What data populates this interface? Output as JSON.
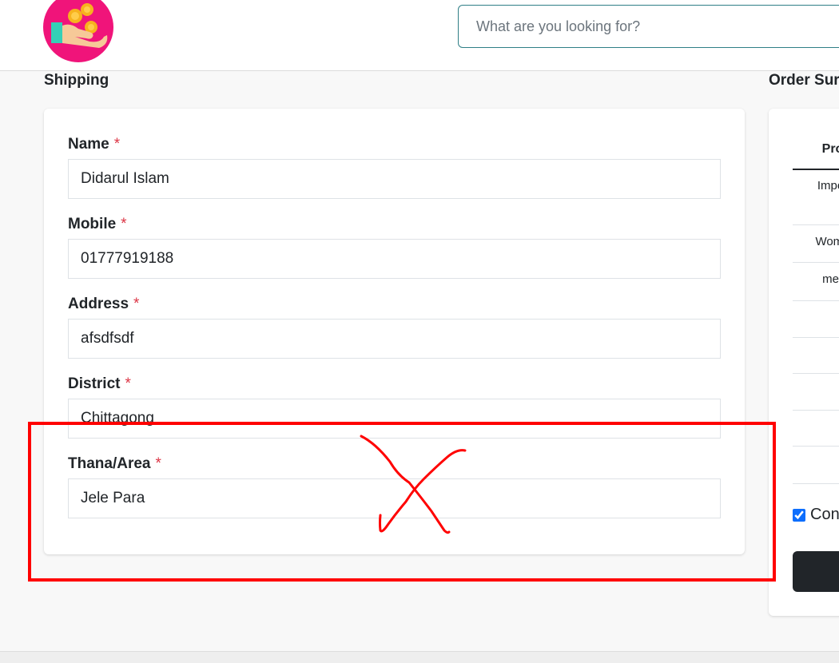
{
  "search": {
    "placeholder": "What are you looking for?"
  },
  "shipping": {
    "title": "Shipping",
    "required_marker": "*",
    "fields": [
      {
        "label": "Name",
        "value": "Didarul Islam"
      },
      {
        "label": "Mobile",
        "value": "01777919188"
      },
      {
        "label": "Address",
        "value": "afsdfsdf"
      },
      {
        "label": "District",
        "value": "Chittagong"
      },
      {
        "label": "Thana/Area",
        "value": "Jele Para"
      }
    ]
  },
  "order_summary": {
    "title": "Order Sur",
    "header": "Pro",
    "rows": [
      "Imper",
      "Wome",
      "mer",
      "",
      "",
      "",
      "",
      ""
    ],
    "checkbox_label": "Con",
    "checkbox_checked": true
  },
  "colors": {
    "annotation_red": "#ff0000",
    "required_red": "#dc3545",
    "search_border": "#2f7f86",
    "logo_pink": "#f0147a"
  }
}
